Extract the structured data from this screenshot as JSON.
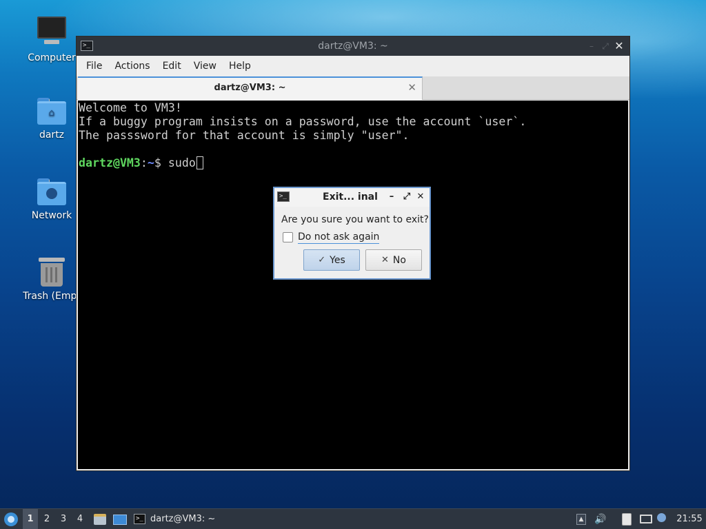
{
  "desktop": {
    "icons": [
      {
        "label": "Computer",
        "icon": "computer-icon"
      },
      {
        "label": "dartz",
        "icon": "home-folder-icon"
      },
      {
        "label": "Network",
        "icon": "network-folder-icon"
      },
      {
        "label": "Trash (Empt",
        "icon": "trash-icon"
      }
    ]
  },
  "window": {
    "title": "dartz@VM3: ~",
    "close_glyph": "✕",
    "minimize_glyph": "–",
    "maximize_glyph": "⤢",
    "menu": [
      "File",
      "Actions",
      "Edit",
      "View",
      "Help"
    ],
    "tab": {
      "label": "dartz@VM3: ~",
      "close_glyph": "✕"
    },
    "terminal": {
      "lines": [
        "Welcome to VM3!",
        "If a buggy program insists on a password, use the account `user`.",
        "The passsword for that account is simply \"user\"."
      ],
      "prompt_user": "dartz@VM3",
      "prompt_sep": ":",
      "prompt_path": "~",
      "prompt_symbol": "$ ",
      "command": "sudo"
    }
  },
  "dialog": {
    "title": "Exit... inal",
    "question": "Are you sure you want to exit?",
    "checkbox_label": "Do not ask again",
    "checkbox_checked": false,
    "yes_label": "Yes",
    "yes_icon": "✓",
    "no_label": "No",
    "no_icon": "✕",
    "minimize_glyph": "–",
    "maximize_glyph": "⤢",
    "close_glyph": "✕"
  },
  "taskbar": {
    "workspaces": [
      "1",
      "2",
      "3",
      "4"
    ],
    "active_workspace": "1",
    "task_label": "dartz@VM3: ~",
    "tray_up_glyph": "▲",
    "volume_glyph": "🔊",
    "clock": "21:55"
  },
  "colors": {
    "accent": "#4a90d9",
    "prompt_user": "#5fd75f",
    "prompt_path": "#6f8cff",
    "terminal_bg": "#000000"
  }
}
